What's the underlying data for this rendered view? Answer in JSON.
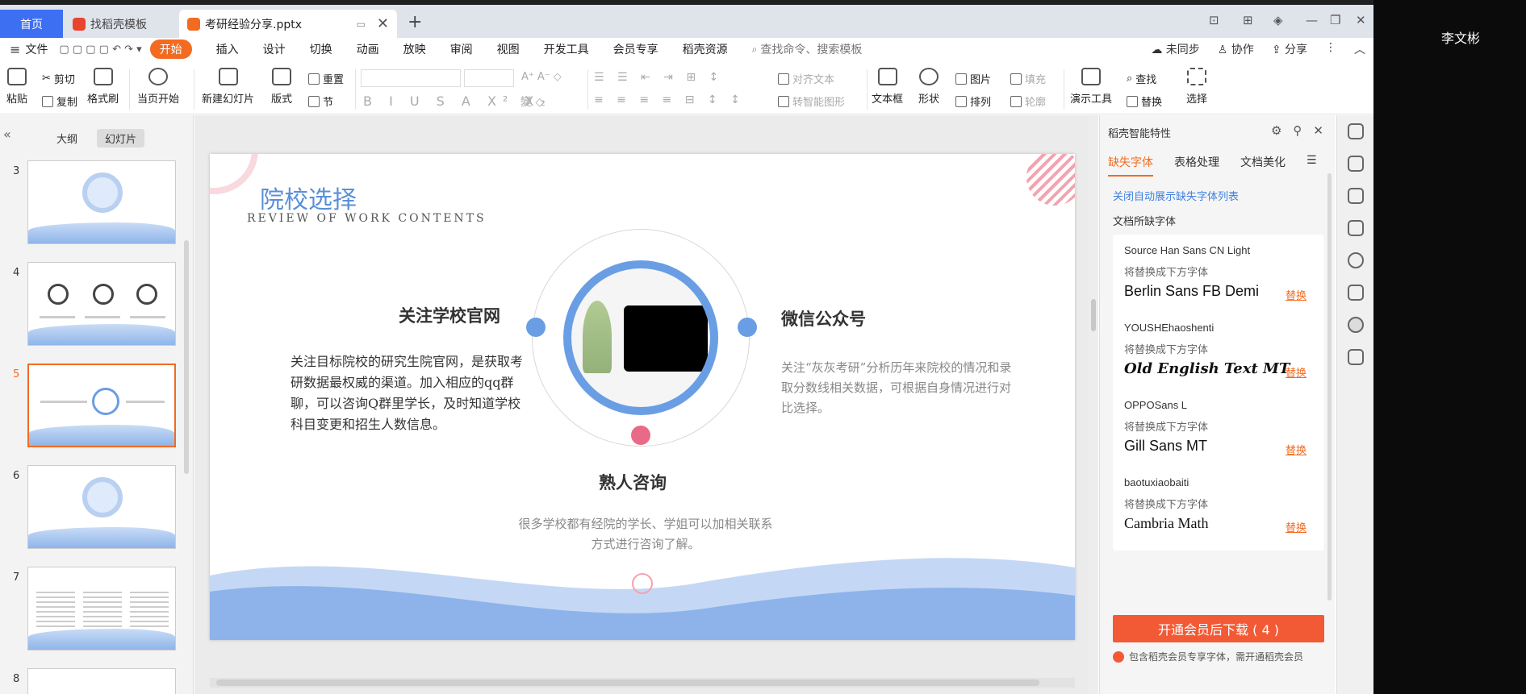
{
  "tabs": {
    "home": "首页",
    "template": "找稻壳模板",
    "file": "考研经验分享.pptx",
    "add": "+"
  },
  "window": {
    "min": "—",
    "restore": "❐",
    "close": "✕",
    "layout1": "⊡",
    "layout2": "⊞"
  },
  "user": {
    "name": "李文彬"
  },
  "menu": {
    "file": "文件",
    "items": [
      "开始",
      "插入",
      "设计",
      "切换",
      "动画",
      "放映",
      "审阅",
      "视图",
      "开发工具",
      "会员专享",
      "稻壳资源"
    ],
    "search": "查找命令、搜索模板",
    "sync": "未同步",
    "collab": "协作",
    "share": "分享"
  },
  "ribbon": {
    "paste": "粘贴",
    "cut": "剪切",
    "copy": "复制",
    "format_painter": "格式刷",
    "from_current": "当页开始",
    "new_slide": "新建幻灯片",
    "layout": "版式",
    "reset": "重置",
    "section": "节",
    "align_text": "对齐文本",
    "convert_smartart": "转智能图形",
    "textbox": "文本框",
    "shape": "形状",
    "picture": "图片",
    "arrange": "排列",
    "fill": "填充",
    "outline": "轮廓",
    "present_tools": "演示工具",
    "find": "查找",
    "replace": "替换",
    "select": "选择"
  },
  "left_panel": {
    "tab_outline": "大纲",
    "tab_slides": "幻灯片",
    "slides": [
      {
        "num": "3"
      },
      {
        "num": "4"
      },
      {
        "num": "5"
      },
      {
        "num": "6"
      },
      {
        "num": "7"
      },
      {
        "num": "8"
      }
    ]
  },
  "slide": {
    "title": "院校选择",
    "subtitle": "REVIEW OF WORK CONTENTS",
    "left_heading": "关注学校官网",
    "left_text": "关注目标院校的研究生院官网，是获取考研数据最权威的渠道。加入相应的qq群聊，可以咨询Q群里学长，及时知道学校科目变更和招生人数信息。",
    "right_heading": "微信公众号",
    "right_text": "关注“灰灰考研”分析历年来院校的情况和录取分数线相关数据，可根据自身情况进行对比选择。",
    "bottom_heading": "熟人咨询",
    "bottom_text": "很多学校都有经院的学长、学姐可以加相关联系方式进行咨询了解。"
  },
  "right_panel": {
    "header": "稻壳智能特性",
    "tabs": [
      "缺失字体",
      "表格处理",
      "文档美化"
    ],
    "link": "关闭自动展示缺失字体列表",
    "section": "文档所缺字体",
    "replace_note": "将替换成下方字体",
    "replace_btn": "替换",
    "fonts": [
      {
        "missing": "Source Han Sans CN Light",
        "replacement": "Berlin Sans FB Demi"
      },
      {
        "missing": "YOUSHEhaoshenti",
        "replacement": "Old English Text MT"
      },
      {
        "missing": "OPPOSans L",
        "replacement": "Gill Sans MT"
      },
      {
        "missing": "baotuxiaobaiti",
        "replacement": "Cambria Math"
      }
    ],
    "vip_button": "开通会员后下载 ( 4 )",
    "vip_note": "包含稻壳会员专享字体，需开通稻壳会员"
  },
  "colors": {
    "accent": "#f26b21",
    "home_tab": "#3d6ff3",
    "slide_blue": "#6a9ee4",
    "node_pink": "#e96a86",
    "vip_red": "#f25a35"
  }
}
